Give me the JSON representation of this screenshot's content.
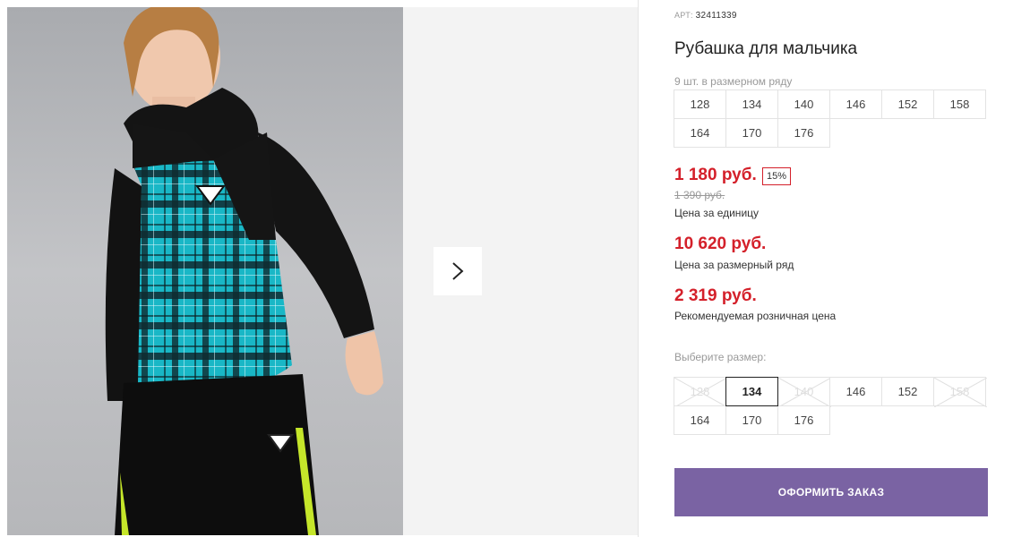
{
  "product": {
    "article_label": "АРТ:",
    "article_number": "32411339",
    "title": "Рубашка для мальчика",
    "pack_note": "9 шт. в размерном ряду",
    "size_row": [
      "128",
      "134",
      "140",
      "146",
      "152",
      "158",
      "164",
      "170",
      "176"
    ]
  },
  "prices": {
    "unit_price": "1 180 руб.",
    "discount": "15%",
    "old_price": "1 390 руб.",
    "unit_label": "Цена за единицу",
    "row_price": "10 620 руб.",
    "row_label": "Цена за размерный ряд",
    "retail_price": "2 319 руб.",
    "retail_label": "Рекомендуемая розничная цена"
  },
  "size_picker": {
    "label": "Выберите размер:",
    "sizes": [
      {
        "size": "128",
        "state": "disabled"
      },
      {
        "size": "134",
        "state": "selected"
      },
      {
        "size": "140",
        "state": "disabled"
      },
      {
        "size": "146",
        "state": "available"
      },
      {
        "size": "152",
        "state": "available"
      },
      {
        "size": "158",
        "state": "disabled"
      },
      {
        "size": "164",
        "state": "available"
      },
      {
        "size": "170",
        "state": "available"
      },
      {
        "size": "176",
        "state": "available"
      }
    ]
  },
  "actions": {
    "order_label": "ОФОРМИТЬ ЗАКАЗ"
  },
  "icons": {
    "next": "chevron-right-icon"
  },
  "colors": {
    "price": "#d4202a",
    "button": "#7a63a3"
  }
}
